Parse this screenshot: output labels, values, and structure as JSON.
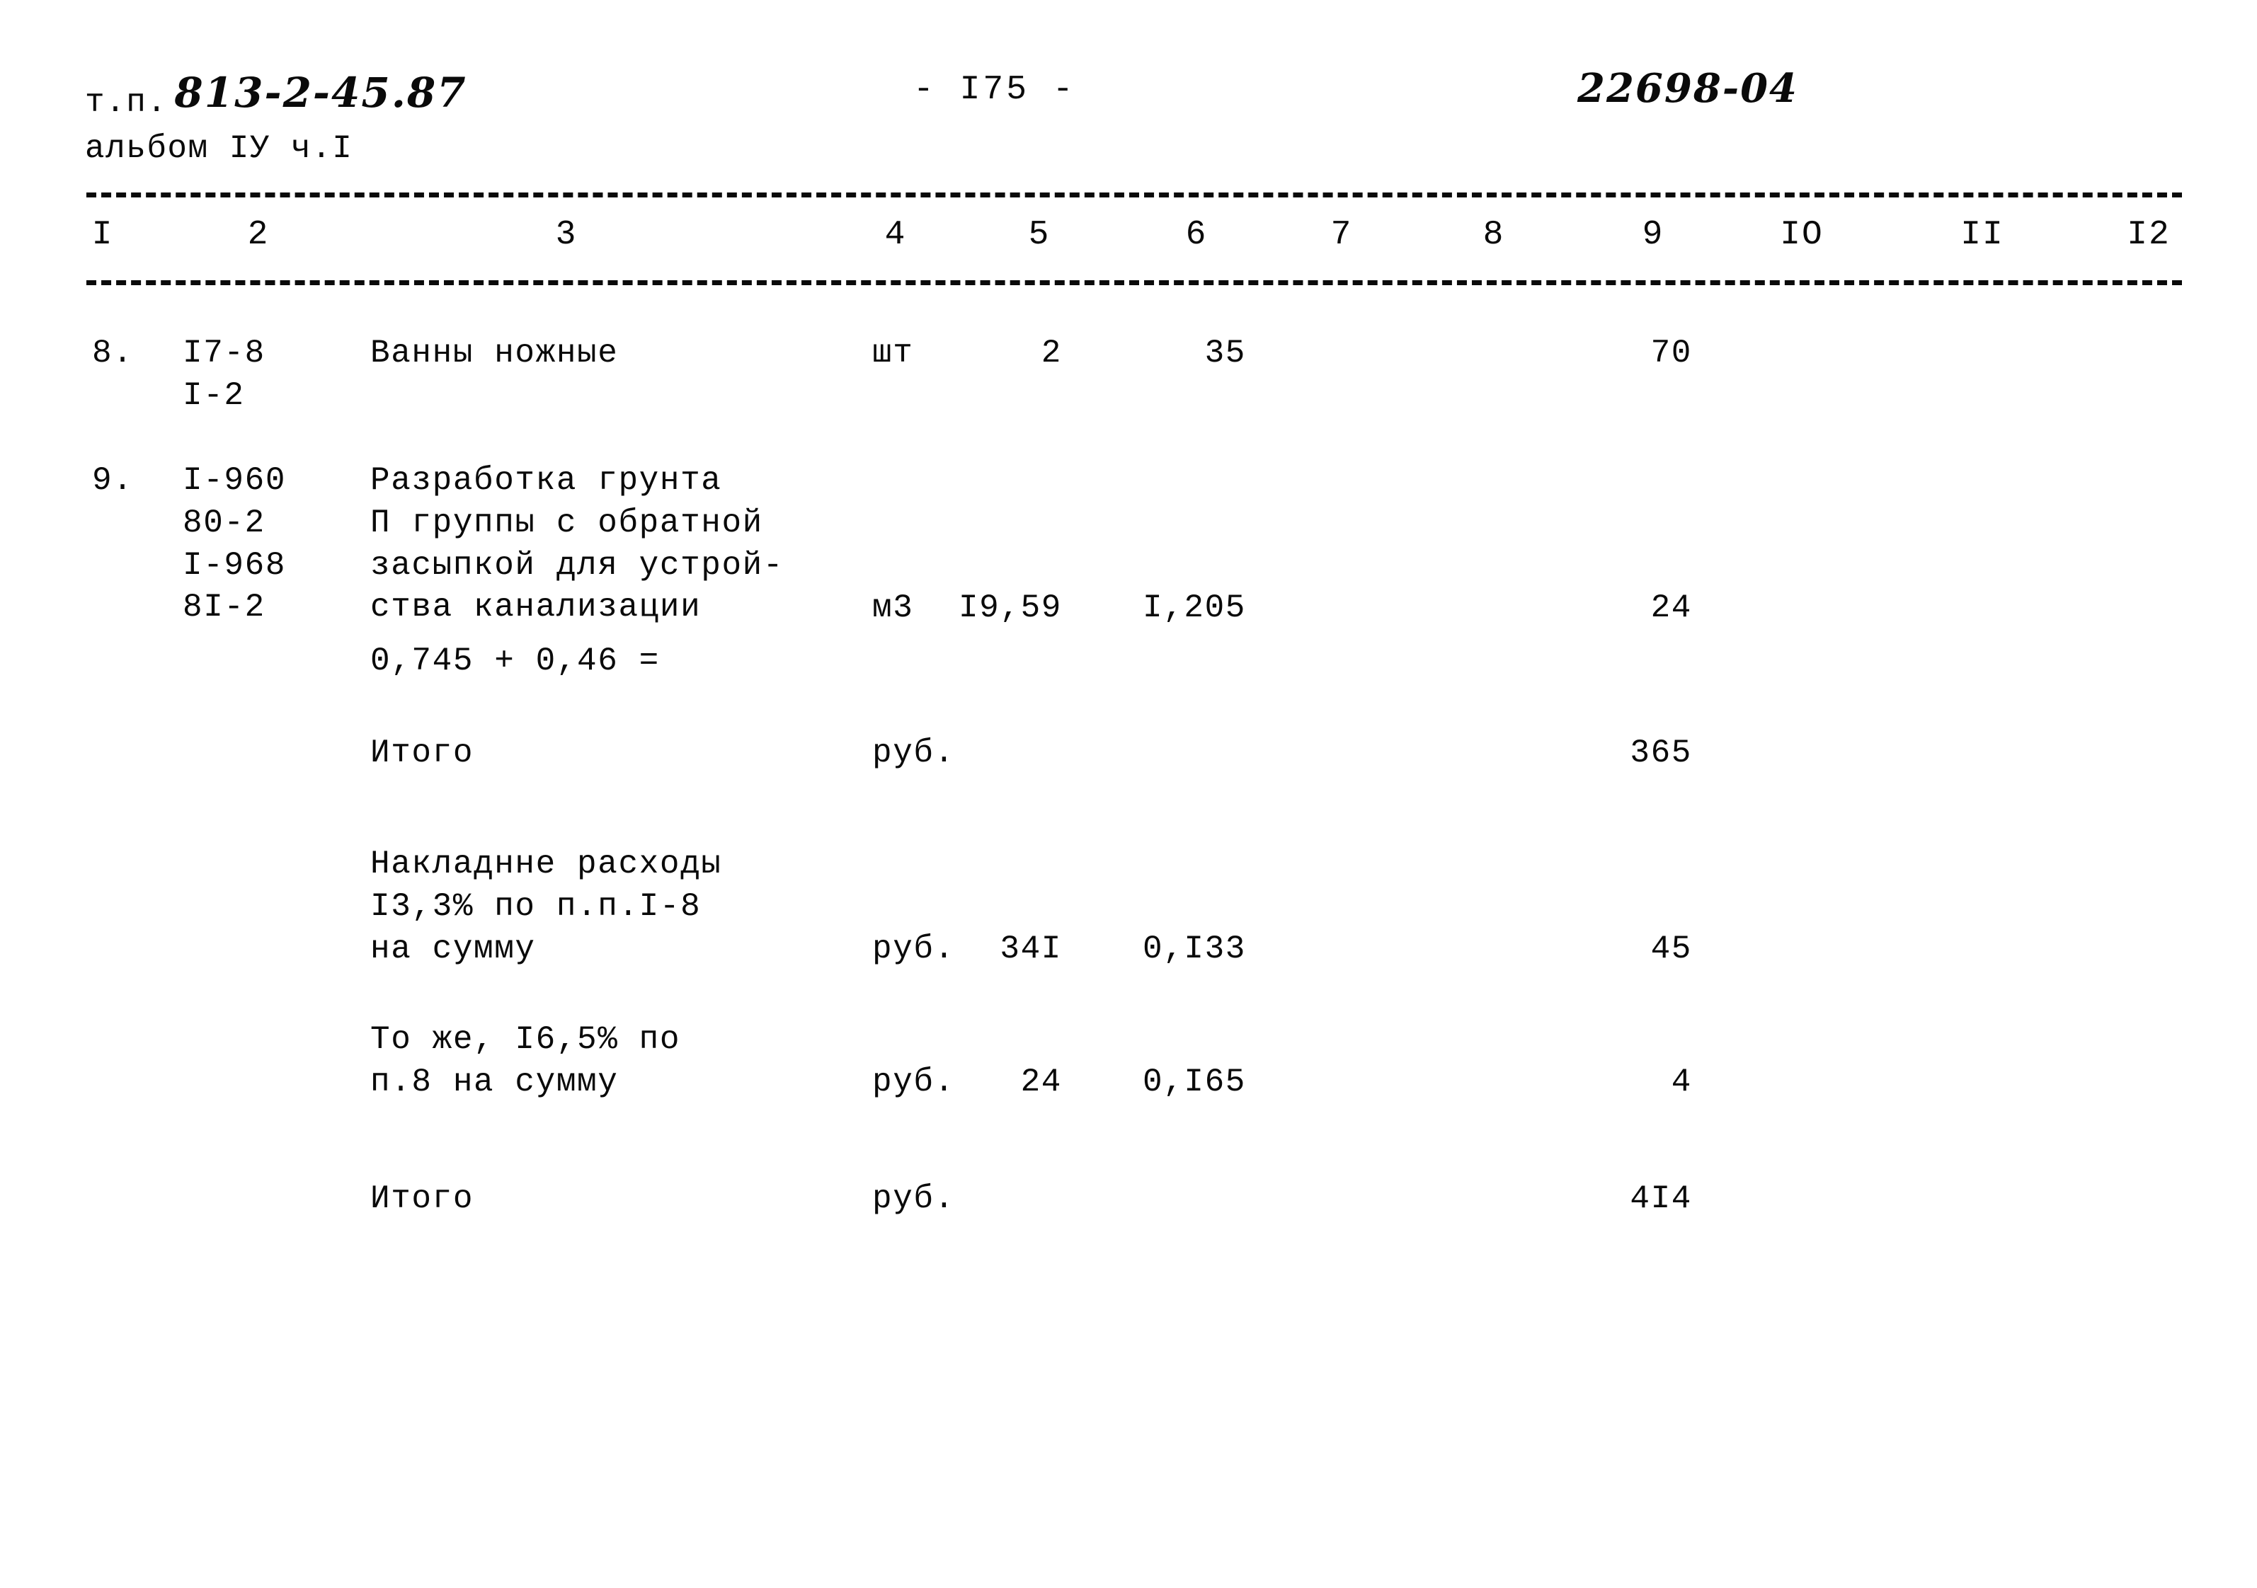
{
  "header": {
    "type_label": "т.п.",
    "type_code": "813-2-45.87",
    "album_label": "альбом IУ ч.I",
    "page_number": "- I75 -",
    "doc_code": "22698-04"
  },
  "table": {
    "column_numbers": [
      "I",
      "2",
      "3",
      "4",
      "5",
      "6",
      "7",
      "8",
      "9",
      "IO",
      "II",
      "I2"
    ],
    "rows": [
      {
        "no": "8.",
        "code_lines": [
          "I7-8",
          "I-2"
        ],
        "desc_lines": [
          "Ванны ножные"
        ],
        "unit": "шт",
        "col5": "2",
        "col6": "35",
        "col9": "70"
      },
      {
        "no": "9.",
        "code_lines": [
          "I-960",
          "80-2",
          "I-968",
          "8I-2"
        ],
        "desc_lines": [
          "Разработка грунта",
          "П группы с обратной",
          "засыпкой для устрой-",
          "ства канализации"
        ],
        "unit": "м3",
        "col5": "I9,59",
        "col6": "I,205",
        "col9": "24"
      },
      {
        "no": "",
        "code_lines": [],
        "desc_lines": [
          "0,745 + 0,46 ="
        ],
        "unit": "",
        "col5": "",
        "col6": "",
        "col9": ""
      },
      {
        "no": "",
        "code_lines": [],
        "desc_lines": [
          "Итого"
        ],
        "unit": "руб.",
        "col5": "",
        "col6": "",
        "col9": "365"
      },
      {
        "no": "",
        "code_lines": [],
        "desc_lines": [
          "Накладнне расходы",
          "I3,3% по п.п.I-8",
          "на сумму"
        ],
        "unit": "руб.",
        "col5": "34I",
        "col6": "0,I33",
        "col9": "45"
      },
      {
        "no": "",
        "code_lines": [],
        "desc_lines": [
          "То же, I6,5% по",
          "п.8 на сумму"
        ],
        "unit": "руб.",
        "col5": "24",
        "col6": "0,I65",
        "col9": "4"
      },
      {
        "no": "",
        "code_lines": [],
        "desc_lines": [
          "Итого"
        ],
        "unit": "руб.",
        "col5": "",
        "col6": "",
        "col9": "4I4"
      }
    ]
  }
}
